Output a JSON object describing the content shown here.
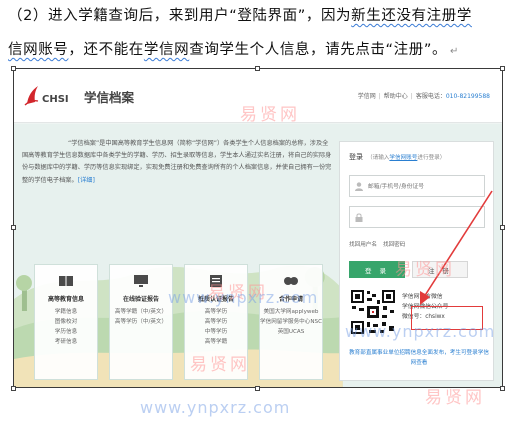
{
  "document": {
    "line1_before": "（2）进入学籍查询后，来到用户“登陆界面”，因为",
    "line1_squiggle": "新生还没有注册学",
    "line2_squiggle1": "信网账号",
    "line2_middle": "，还不能在",
    "line2_squiggle2": "学信网",
    "line2_after": "查询学生个人信息，请先点击“注册”。",
    "return_mark": "↵"
  },
  "site": {
    "logo_text": "CHSI",
    "title": "学信档案",
    "nav": [
      "学信网",
      "帮助中心",
      "客服电话："
    ],
    "phone": "010-82199588",
    "intro_pre": "“学信档案”是中国高等教育学生信息网（简称“学信网”）各类学生个人信息档案的总称，涉及全国高等教育学生信息数据库中各类学生的学籍、学历、招生录取等信息，学生本人通过实名注册，将自己的实际身份与数据库中的学籍、学历等信息实现绑定，实现免费注册和免费查询所有的个人档案信息，并使自己拥有一份完整的学信电子档案。",
    "intro_link": "[详细]"
  },
  "cards": [
    {
      "title": "高等教育信息",
      "items": [
        "学籍信息",
        "图像校对",
        "学历信息",
        "考研信息"
      ]
    },
    {
      "title": "在线验证报告",
      "items": [
        "高等学籍（中/英文）",
        "高等学历（中/英文）"
      ]
    },
    {
      "title": "抵质认证报告",
      "items": [
        "高等学历",
        "高等学历",
        "中等学历",
        "高等学籍"
      ]
    },
    {
      "title": "合作申请",
      "items": [
        "美国大学网applyweb",
        "学信网留学服务中心NSC",
        "英国UCAS"
      ]
    }
  ],
  "login": {
    "title": "登录",
    "hint_pre": "（请输入",
    "hint_acct": "学信网账号",
    "hint_post": "进行登录）",
    "username_placeholder": "邮箱/手机号/身份证号",
    "password_placeholder": "",
    "link_register_name": "找回用户名",
    "link_find_pwd": "找回密码",
    "login_button": "登 录",
    "register_button": "注 册",
    "wx_lines": [
      "学信网官方微信",
      "学信网微信公众号",
      "微信号：chsiwx"
    ],
    "jobs_text": "教育部直属事业单位招聘信息全面发布，考生可登录学信网查看"
  },
  "watermarks": {
    "cn": "易贤网",
    "url": "www.ynpxrz.com"
  },
  "colors": {
    "brand_green": "#37a56b",
    "link_blue": "#2a7fd1",
    "highlight_red": "#e23b3b"
  }
}
